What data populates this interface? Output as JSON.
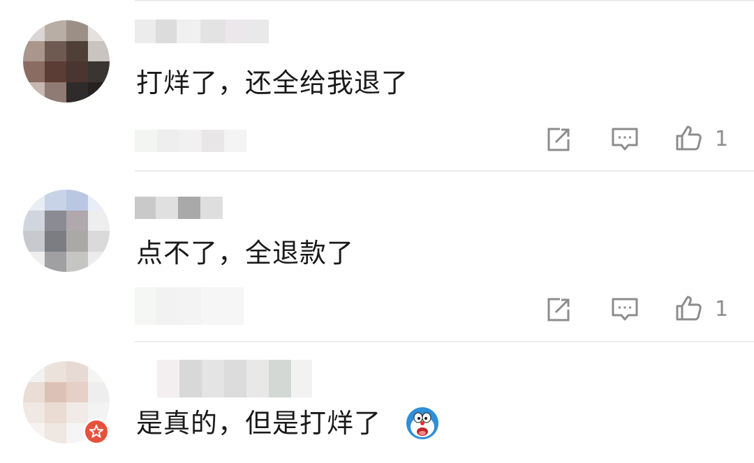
{
  "comments": [
    {
      "text": "打烊了，还全给我退了",
      "likes": "1"
    },
    {
      "text": "点不了，全退款了",
      "likes": "1"
    },
    {
      "text": "是真的，但是打烊了"
    }
  ],
  "icons": {
    "share": "share-icon",
    "reply": "comment-icon",
    "like": "thumbs-up-icon",
    "emoji": "doraemon-emoji-icon",
    "badge": "verified-star-badge-icon"
  },
  "colors": {
    "text": "#1a1a1a",
    "icon": "#8c8c8c",
    "badge": "#e8513b",
    "divider": "#ececec"
  }
}
